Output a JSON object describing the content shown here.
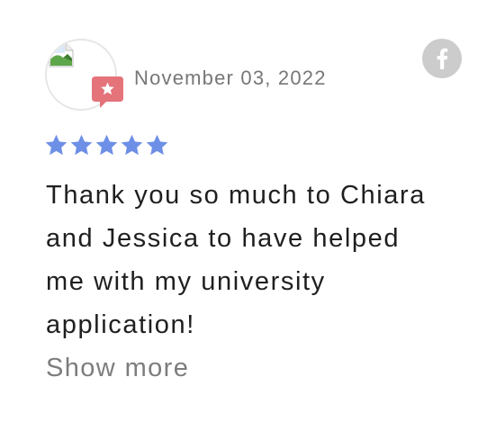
{
  "review": {
    "date": "November 03, 2022",
    "rating": 5,
    "text": "Thank you so much to Chiara and Jessica to have helped me with my university application!",
    "show_more_label": "Show more"
  },
  "icons": {
    "avatar": "broken-image-icon",
    "badge": "star-badge-icon",
    "share": "facebook-icon",
    "rating": "star-icon"
  },
  "colors": {
    "star": "#6d8fe6",
    "badge": "#e5737a",
    "share_button": "#cccccc",
    "date_text": "#777777",
    "body_text": "#1f1f1f",
    "show_more_text": "#7d7d7d"
  }
}
